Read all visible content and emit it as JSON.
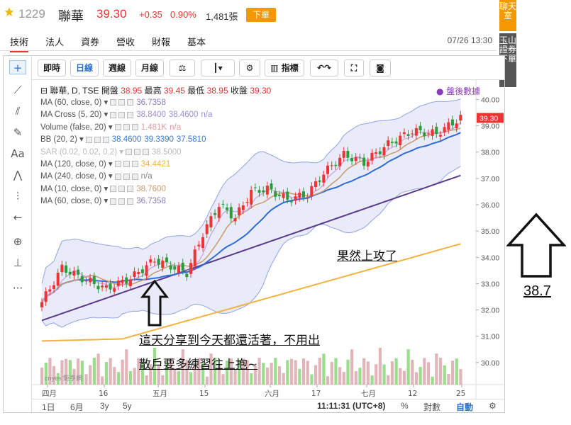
{
  "stock": {
    "code": "1229",
    "name": "聯華",
    "price": "39.30",
    "change": "+0.35",
    "pct": "0.90%",
    "volume": "1,481張",
    "action": "下單"
  },
  "tabs": [
    "技術",
    "法人",
    "資券",
    "營收",
    "財報",
    "基本"
  ],
  "datetime": "07/26 13:30",
  "side": {
    "chat": "聊天室",
    "broker": "玉山證券下單"
  },
  "toolbar": {
    "buttons": [
      "即時",
      "日線",
      "週線",
      "月線",
      "指標"
    ]
  },
  "legend": {
    "title": "聯華, D, TSE",
    "ohlc": {
      "open_label": "開盤",
      "open": "38.95",
      "high_label": "最高",
      "high": "39.45",
      "low_label": "最低",
      "low": "38.95",
      "close_label": "收盤",
      "close": "39.30"
    },
    "after": "盤後數據",
    "rows": [
      {
        "label": "MA (60, close, 0)",
        "values": [
          "36.7358"
        ],
        "color": "#8a7cc9"
      },
      {
        "label": "MA Cross (5, 20)",
        "values": [
          "38.8400",
          "38.4600",
          "n/a"
        ],
        "color": "#9b8fd6"
      },
      {
        "label": "Volume (false, 20)",
        "values": [
          "1.481K",
          "n/a"
        ],
        "color": "#e39aa0"
      },
      {
        "label": "BB (20, 2)",
        "values": [
          "38.4600",
          "39.3390",
          "37.5810"
        ],
        "color": "#3a78d8"
      },
      {
        "label": "SAR (0.02, 0.02, 0.2)",
        "values": [
          "38.5000"
        ],
        "color": "#bbbbbb"
      },
      {
        "label": "MA (120, close, 0)",
        "values": [
          "34.4421"
        ],
        "color": "#f2b440"
      },
      {
        "label": "MA (240, close, 0)",
        "values": [
          "n/a"
        ],
        "color": "#888888"
      },
      {
        "label": "MA (10, close, 0)",
        "values": [
          "38.7600"
        ],
        "color": "#c89a6e"
      },
      {
        "label": "MA (60, close, 0)",
        "values": [
          "36.7358"
        ],
        "color": "#8a7cc9"
      }
    ]
  },
  "axis": {
    "y_ticks": [
      "40.00",
      "39.00",
      "38.00",
      "37.00",
      "36.00",
      "35.00",
      "34.00",
      "33.00",
      "32.00",
      "31.00",
      "30.00"
    ],
    "last_price": "39.30",
    "x_ticks": [
      "四月",
      "16",
      "五月",
      "15",
      "六月",
      "17",
      "七月",
      "12",
      "25"
    ]
  },
  "bottom": {
    "ranges": [
      "1日",
      "6月",
      "3y",
      "5y"
    ],
    "time": "11:11:31 (UTC+8)",
    "pct": "%",
    "log": "對數",
    "auto": "自動"
  },
  "annotations": {
    "up": "果然上攻了",
    "note1": "這天分享到今天都還活著，不用出",
    "note2": "散戶要多練習往上抱~",
    "target": "38.7"
  },
  "watermark": "cnyes 鉅亨網"
}
